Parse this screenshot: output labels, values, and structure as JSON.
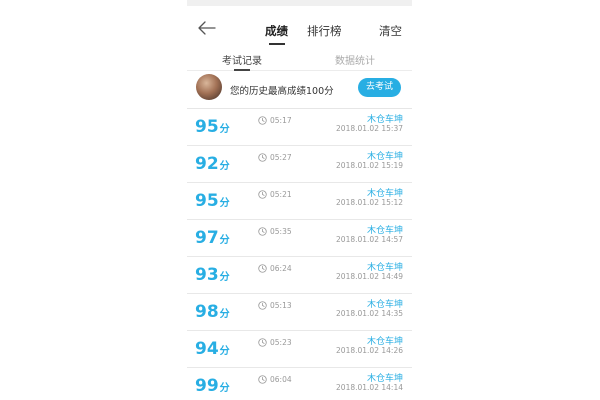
{
  "header": {
    "tabs": [
      {
        "label": "成绩",
        "active": true
      },
      {
        "label": "排行榜",
        "active": false
      }
    ],
    "clear_label": "清空"
  },
  "subtabs": [
    {
      "label": "考试记录",
      "active": true
    },
    {
      "label": "数据统计",
      "active": false
    }
  ],
  "best": {
    "text": "您的历史最高成绩100分",
    "button_label": "去考试"
  },
  "records": [
    {
      "score": "95",
      "unit": "分",
      "duration": "05:17",
      "user": "木仓车坤",
      "date": "2018.01.02",
      "time": "15:37"
    },
    {
      "score": "92",
      "unit": "分",
      "duration": "05:27",
      "user": "木仓车坤",
      "date": "2018.01.02",
      "time": "15:19"
    },
    {
      "score": "95",
      "unit": "分",
      "duration": "05:21",
      "user": "木仓车坤",
      "date": "2018.01.02",
      "time": "15:12"
    },
    {
      "score": "97",
      "unit": "分",
      "duration": "05:35",
      "user": "木仓车坤",
      "date": "2018.01.02",
      "time": "14:57"
    },
    {
      "score": "93",
      "unit": "分",
      "duration": "06:24",
      "user": "木仓车坤",
      "date": "2018.01.02",
      "time": "14:49"
    },
    {
      "score": "98",
      "unit": "分",
      "duration": "05:13",
      "user": "木仓车坤",
      "date": "2018.01.02",
      "time": "14:35"
    },
    {
      "score": "94",
      "unit": "分",
      "duration": "05:23",
      "user": "木仓车坤",
      "date": "2018.01.02",
      "time": "14:26"
    },
    {
      "score": "99",
      "unit": "分",
      "duration": "06:04",
      "user": "木仓车坤",
      "date": "2018.01.02",
      "time": "14:14"
    }
  ],
  "icons": {
    "back": "arrow-left-icon",
    "clock": "clock-icon",
    "avatar": "avatar"
  },
  "colors": {
    "accent": "#28aee3",
    "muted": "#999999",
    "text": "#333333"
  }
}
